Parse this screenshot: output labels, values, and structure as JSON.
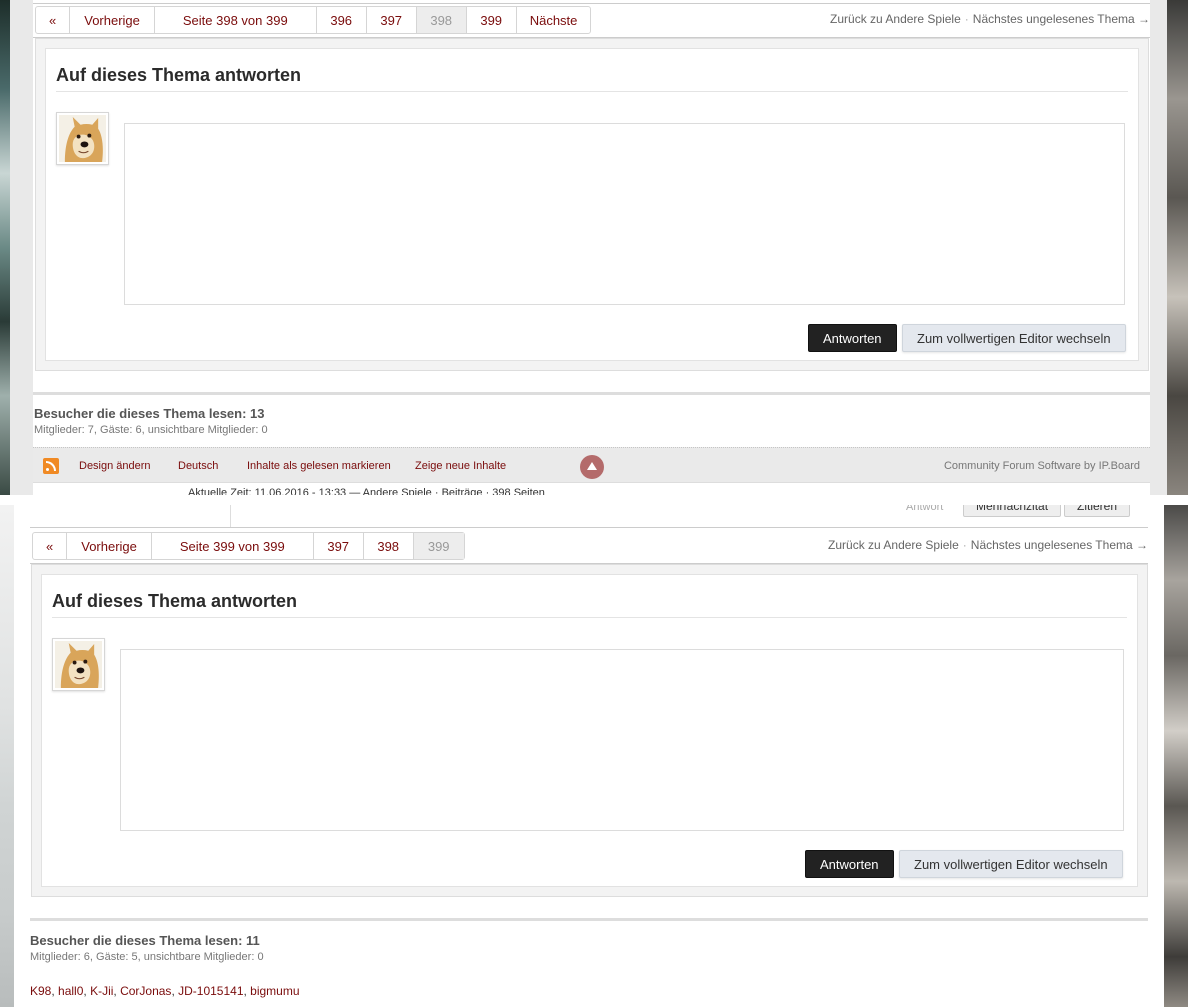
{
  "top": {
    "pagination": {
      "first": "«",
      "prev": "Vorherige",
      "page_info": "Seite 398 von 399",
      "pages": [
        "396",
        "397",
        "398",
        "399"
      ],
      "current": "398",
      "next": "Nächste"
    },
    "nav": {
      "back": "Zurück zu Andere Spiele",
      "separator": "·",
      "next_unread": "Nächstes ungelesenes Thema →"
    },
    "reply": {
      "title": "Auf dieses Thema antworten",
      "submit": "Antworten",
      "full_editor": "Zum vollwertigen Editor wechseln"
    },
    "viewers": {
      "title": "Besucher die dieses Thema lesen: 13",
      "subtitle": "Mitglieder: 7, Gäste: 6, unsichtbare Mitglieder: 0"
    },
    "footer": {
      "change_theme": "Design ändern",
      "language": "Deutsch",
      "mark_read": "Inhalte als gelesen markieren",
      "new_content": "Zeige neue Inhalte",
      "powered_by": "Community Forum Software by IP.Board",
      "cut_text": "Aktuelle Zeit: 11.06.2016 - 13:33 — Andere Spiele · Beiträge · 398 Seiten"
    },
    "colors": {
      "link": "#7a0c0c",
      "button_dark": "#222222",
      "button_light": "#e4e8ee"
    }
  },
  "bottom": {
    "ghost": {
      "label": "Antwort",
      "multi_quote": "Mehrfachzitat",
      "quote": "Zitieren"
    },
    "pagination": {
      "first": "«",
      "prev": "Vorherige",
      "page_info": "Seite 399 von 399",
      "pages": [
        "397",
        "398",
        "399"
      ],
      "current": "399"
    },
    "nav": {
      "back": "Zurück zu Andere Spiele",
      "separator": "·",
      "next_unread": "Nächstes ungelesenes Thema →"
    },
    "reply": {
      "title": "Auf dieses Thema antworten",
      "submit": "Antworten",
      "full_editor": "Zum vollwertigen Editor wechseln"
    },
    "viewers": {
      "title": "Besucher die dieses Thema lesen: 11",
      "subtitle": "Mitglieder: 6, Gäste: 5, unsichtbare Mitglieder: 0",
      "names": [
        "K98",
        "hall0",
        "K-Jii",
        "CorJonas",
        "JD-1015141",
        "bigmumu"
      ]
    }
  }
}
